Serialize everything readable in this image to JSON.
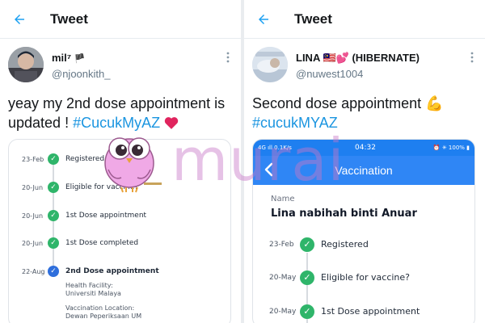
{
  "left": {
    "header": {
      "title": "Tweet"
    },
    "user": {
      "name": "mil⁷",
      "flag_emoji": "🏴",
      "handle": "@njoonkith_"
    },
    "tweet": {
      "text": "yeay my 2nd dose appointment is updated ! ",
      "hashtag": "#CucukMyAZ",
      "emoji": "❤️"
    },
    "timeline": [
      {
        "date": "23-Feb",
        "label": "Registered"
      },
      {
        "date": "20-Jun",
        "label": "Eligible for vaccine?"
      },
      {
        "date": "20-Jun",
        "label": "1st Dose appointment"
      },
      {
        "date": "20-Jun",
        "label": "1st Dose completed"
      },
      {
        "date": "22-Aug",
        "label": "2nd Dose appointment"
      }
    ],
    "details": {
      "facility_label": "Health Facility:",
      "facility_value": "Universiti Malaya",
      "location_label": "Vaccination Location:",
      "location_value": "Dewan Peperiksaan UM"
    }
  },
  "right": {
    "header": {
      "title": "Tweet"
    },
    "user": {
      "name": "LINA 🇲🇾💕 (HIBERNATE)",
      "handle": "@nuwest1004"
    },
    "tweet": {
      "text": "Second dose appointment ",
      "emoji": "💪",
      "hashtag": "#cucukMYAZ"
    },
    "phone": {
      "status_left": "4G ıll 0.1K/s",
      "time": "04:32",
      "status_right": "⏰ ✳ 100% ▮",
      "app_title": "Vaccination",
      "name_label": "Name",
      "name_value": "Lina nabihah binti Anuar",
      "rows": [
        {
          "date": "23-Feb",
          "label": "Registered"
        },
        {
          "date": "20-May",
          "label": "Eligible for vaccine?"
        },
        {
          "date": "20-May",
          "label": "1st Dose appointment"
        }
      ]
    }
  },
  "watermark": {
    "text": "murai"
  },
  "colors": {
    "twitter_blue": "#1da1f2",
    "hashtag": "#1b95e0",
    "check_green": "#2fb56a",
    "check_blue": "#2f6fdc",
    "app_blue": "#2f86f5",
    "watermark_pink": "#c878c8"
  },
  "icons": [
    "back-arrow-icon",
    "more-options-icon",
    "check-circle-icon",
    "heart-icon",
    "flexed-biceps-icon",
    "owl-logo-icon"
  ]
}
